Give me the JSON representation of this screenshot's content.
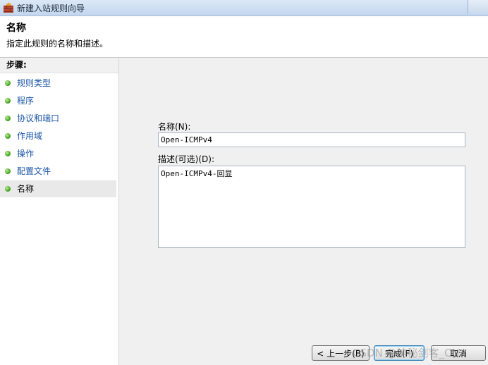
{
  "window": {
    "title": "新建入站规则向导"
  },
  "header": {
    "title": "名称",
    "description": "指定此规则的名称和描述。"
  },
  "steps": {
    "heading": "步骤:",
    "items": [
      {
        "label": "规则类型"
      },
      {
        "label": "程序"
      },
      {
        "label": "协议和端口"
      },
      {
        "label": "作用域"
      },
      {
        "label": "操作"
      },
      {
        "label": "配置文件"
      },
      {
        "label": "名称",
        "current": true
      }
    ]
  },
  "form": {
    "name_label": "名称(N):",
    "name_value": "Open-ICMPv4",
    "desc_label": "描述(可选)(D):",
    "desc_value": "Open-ICMPv4-回显"
  },
  "buttons": {
    "back": "< 上一步(B)",
    "finish": "完成(F)",
    "cancel": "取消"
  },
  "watermark": "CSDN @神秘剑客_CN",
  "icons": {
    "app": "firewall-icon",
    "step_marker": "green-dot-icon"
  }
}
